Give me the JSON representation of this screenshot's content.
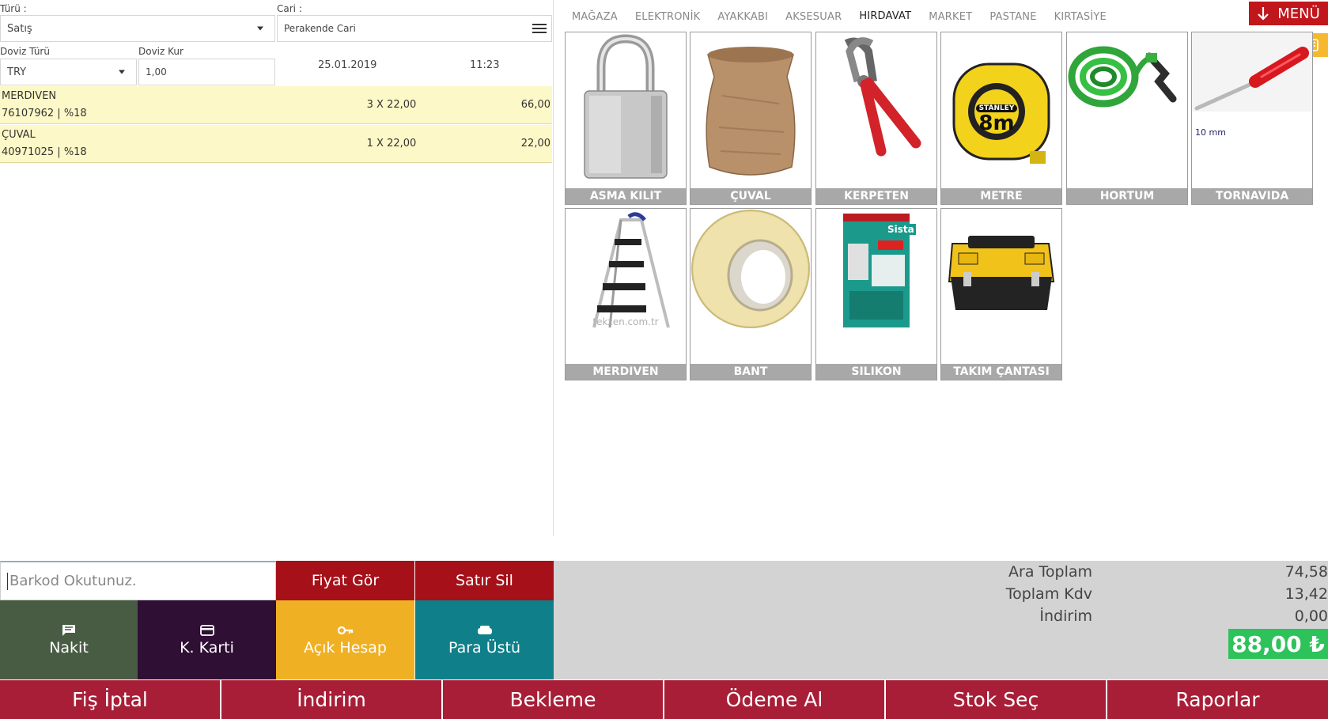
{
  "header": {
    "type_label": "Türü :",
    "type_value": "Satış",
    "account_label": "Cari :",
    "account_value": "Perakende Cari",
    "currency_label": "Doviz Türü",
    "currency_value": "TRY",
    "rate_label": "Doviz Kur",
    "rate_value": "1,00",
    "date": "25.01.2019",
    "time": "11:23"
  },
  "lines": [
    {
      "name": "MERDIVEN",
      "code": "76107962 | %18",
      "qty": "3 X 22,00",
      "total": "66,00"
    },
    {
      "name": "ÇUVAL",
      "code": "40971025 | %18",
      "qty": "1 X 22,00",
      "total": "22,00"
    }
  ],
  "tabs": [
    "MAĞAZA",
    "ELEKTRONİK",
    "AYAKKABI",
    "AKSESUAR",
    "HIRDAVAT",
    "MARKET",
    "PASTANE",
    "KIRTASİYE"
  ],
  "active_tab": "HIRDAVAT",
  "menu_label": "MENÜ",
  "products": [
    {
      "name": "ASMA KILIT",
      "icon": "padlock"
    },
    {
      "name": "ÇUVAL",
      "icon": "sack"
    },
    {
      "name": "KERPETEN",
      "icon": "pliers"
    },
    {
      "name": "METRE",
      "icon": "tape-measure",
      "img_text": "8m",
      "brand_text": "STANLEY"
    },
    {
      "name": "HORTUM",
      "icon": "garden-hose"
    },
    {
      "name": "TORNAVIDA",
      "icon": "screwdriver",
      "img_text": "10 mm"
    },
    {
      "name": "MERDIVEN",
      "icon": "ladder",
      "img_text": "tekzen.com.tr"
    },
    {
      "name": "BANT",
      "icon": "tape-roll"
    },
    {
      "name": "SILIKON",
      "icon": "silicone-tube",
      "brand_text": "Sista"
    },
    {
      "name": "TAKIM ÇANTASI",
      "icon": "toolbox"
    }
  ],
  "barcode_placeholder": "Barkod Okutunuz.",
  "buttons": {
    "price_check": "Fiyat Gör",
    "delete_line": "Satır Sil",
    "cash": "Nakit",
    "card": "K. Karti",
    "open_account": "Açık Hesap",
    "change": "Para Üstü"
  },
  "summary": {
    "subtotal_label": "Ara Toplam",
    "subtotal": "74,58",
    "tax_label": "Toplam Kdv",
    "tax": "13,42",
    "discount_label": "İndirim",
    "discount": "0,00",
    "grand_total": "88,00 ₺"
  },
  "footer": [
    "Fiş İptal",
    "İndirim",
    "Bekleme",
    "Ödeme Al",
    "Stok Seç",
    "Raporlar"
  ],
  "colors": {
    "footer": "#a81e37",
    "red_button": "#a61018",
    "cash": "#485c44",
    "card": "#2f0f34",
    "open_account": "#f0b023",
    "change": "#0f8089",
    "grand_total": "#2ec25a",
    "line_highlight": "#fdf8c7"
  }
}
